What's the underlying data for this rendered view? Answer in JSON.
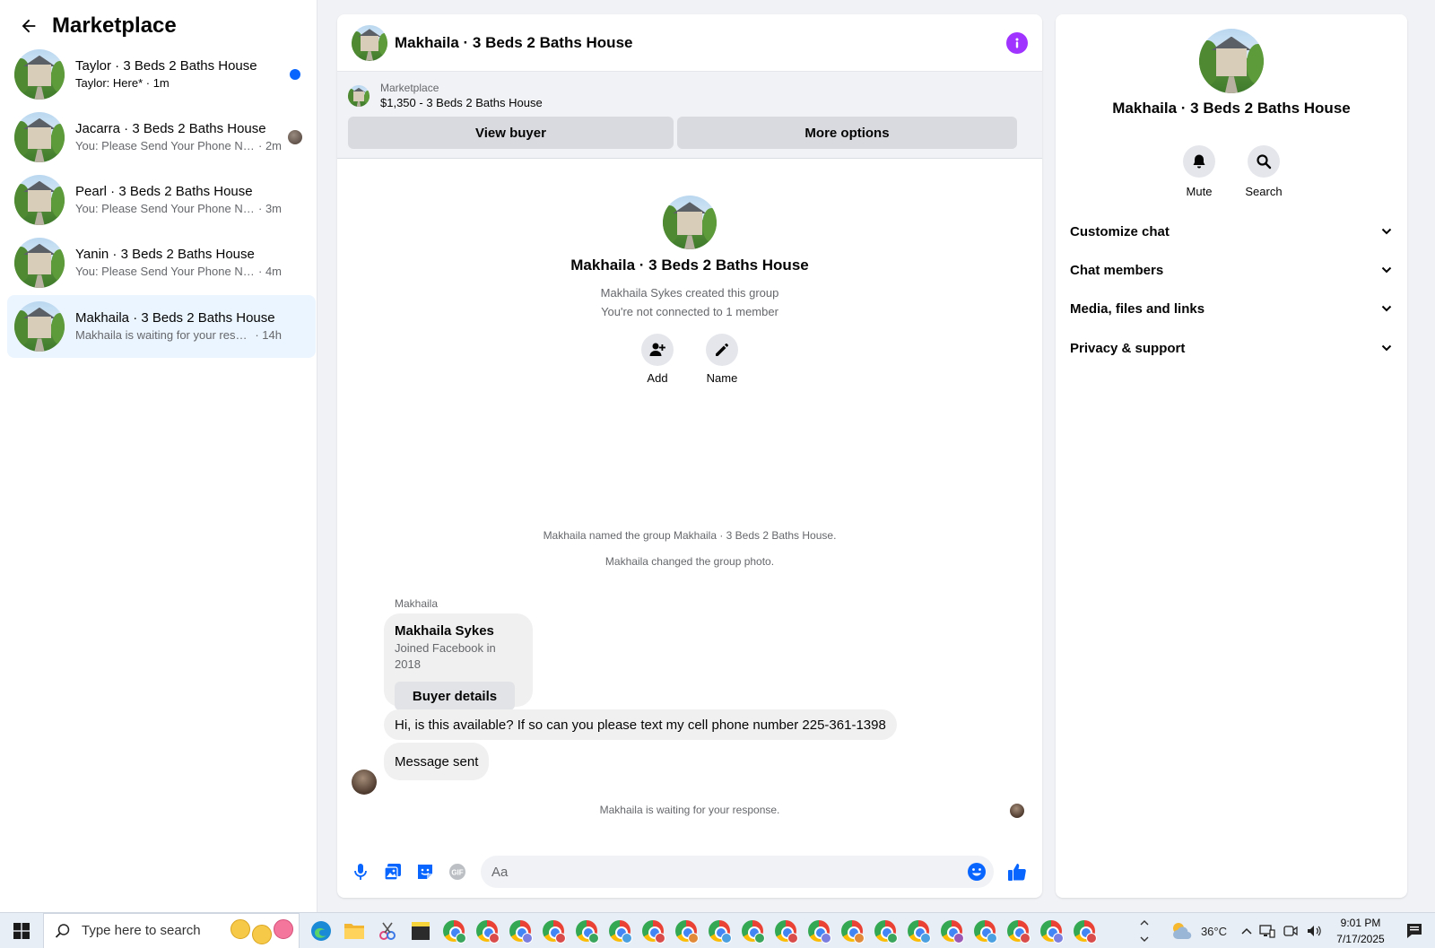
{
  "sidebar": {
    "title": "Marketplace",
    "conversations": [
      {
        "name": "Taylor · 3 Beds 2 Baths House",
        "preview": "Taylor: Here*",
        "time": "· 1m"
      },
      {
        "name": "Jacarra · 3 Beds 2 Baths House",
        "preview": "You: Please Send Your Phone Num...",
        "time": "· 2m"
      },
      {
        "name": "Pearl · 3 Beds 2 Baths House",
        "preview": "You: Please Send Your Phone Numbe...",
        "time": "· 3m"
      },
      {
        "name": "Yanin · 3 Beds 2 Baths House",
        "preview": "You: Please Send Your Phone Numbe...",
        "time": "· 4m"
      },
      {
        "name": "Makhaila · 3 Beds 2 Baths House",
        "preview": "Makhaila is waiting for your response.",
        "time": "· 14h"
      }
    ]
  },
  "chat": {
    "title": "Makhaila · 3 Beds 2 Baths House",
    "listing": {
      "source": "Marketplace",
      "price_title": "$1,350 - 3 Beds 2 Baths House",
      "view_buyer": "View buyer",
      "more_options": "More options"
    },
    "intro": {
      "title": "Makhaila · 3 Beds 2 Baths House",
      "created": "Makhaila Sykes created this group",
      "connected": "You're not connected to 1 member",
      "add_label": "Add",
      "name_label": "Name"
    },
    "system_messages": [
      "Makhaila named the group Makhaila · 3 Beds 2 Baths House.",
      "Makhaila changed the group photo."
    ],
    "sender": "Makhaila",
    "profile_card": {
      "name": "Makhaila Sykes",
      "joined": "Joined Facebook in 2018",
      "button": "Buyer details"
    },
    "messages": [
      "Hi, is this available? If so can you please text my cell phone number 225-361-1398",
      "Message sent"
    ],
    "waiting": "Makhaila is waiting for your response.",
    "composer_placeholder": "Aa"
  },
  "details": {
    "title": "Makhaila · 3 Beds 2 Baths House",
    "mute": "Mute",
    "search": "Search",
    "sections": [
      "Customize chat",
      "Chat members",
      "Media, files and links",
      "Privacy & support"
    ]
  },
  "taskbar": {
    "search_placeholder": "Type here to search",
    "temperature": "36°C",
    "time": "9:01 PM",
    "date": "7/17/2025"
  },
  "colors": {
    "accent": "#0866ff",
    "info": "#a033ff",
    "active_row": "#ebf5ff"
  }
}
